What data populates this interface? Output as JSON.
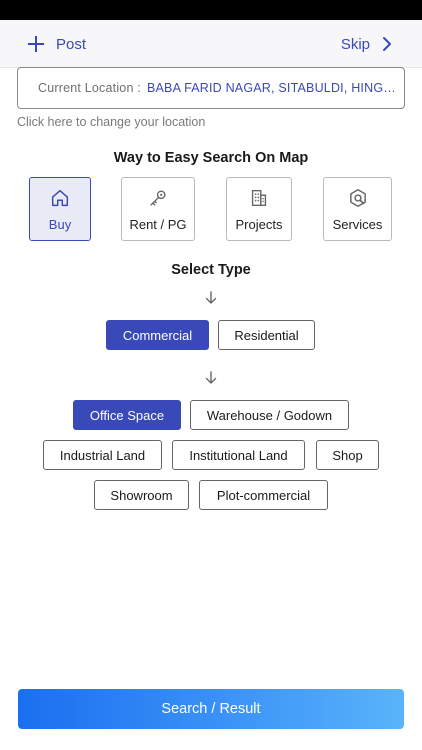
{
  "header": {
    "post_label": "Post",
    "skip_label": "Skip"
  },
  "location": {
    "label": "Current Location :",
    "value": "BABA FARID NAGAR, SITABULDI, HINGAN...",
    "change_hint": "Click here to change your location"
  },
  "search_map": {
    "title": "Way to Easy Search On Map",
    "categories": [
      {
        "label": "Buy",
        "icon": "home-icon",
        "selected": true
      },
      {
        "label": "Rent / PG",
        "icon": "key-icon",
        "selected": false
      },
      {
        "label": "Projects",
        "icon": "building-icon",
        "selected": false
      },
      {
        "label": "Services",
        "icon": "services-icon",
        "selected": false
      }
    ]
  },
  "select_type": {
    "title": "Select Type",
    "types": [
      {
        "label": "Commercial",
        "selected": true
      },
      {
        "label": "Residential",
        "selected": false
      }
    ],
    "subtypes": [
      {
        "label": "Office Space",
        "selected": true
      },
      {
        "label": "Warehouse / Godown",
        "selected": false
      },
      {
        "label": "Industrial Land",
        "selected": false
      },
      {
        "label": "Institutional Land",
        "selected": false
      },
      {
        "label": "Shop",
        "selected": false
      },
      {
        "label": "Showroom",
        "selected": false
      },
      {
        "label": "Plot-commercial",
        "selected": false
      }
    ]
  },
  "footer": {
    "search_label": "Search / Result"
  },
  "colors": {
    "accent": "#3a49b8",
    "selected_card_bg": "#e9ebf7",
    "button_gradient_start": "#1a6ff0",
    "button_gradient_end": "#5ab4fb"
  }
}
